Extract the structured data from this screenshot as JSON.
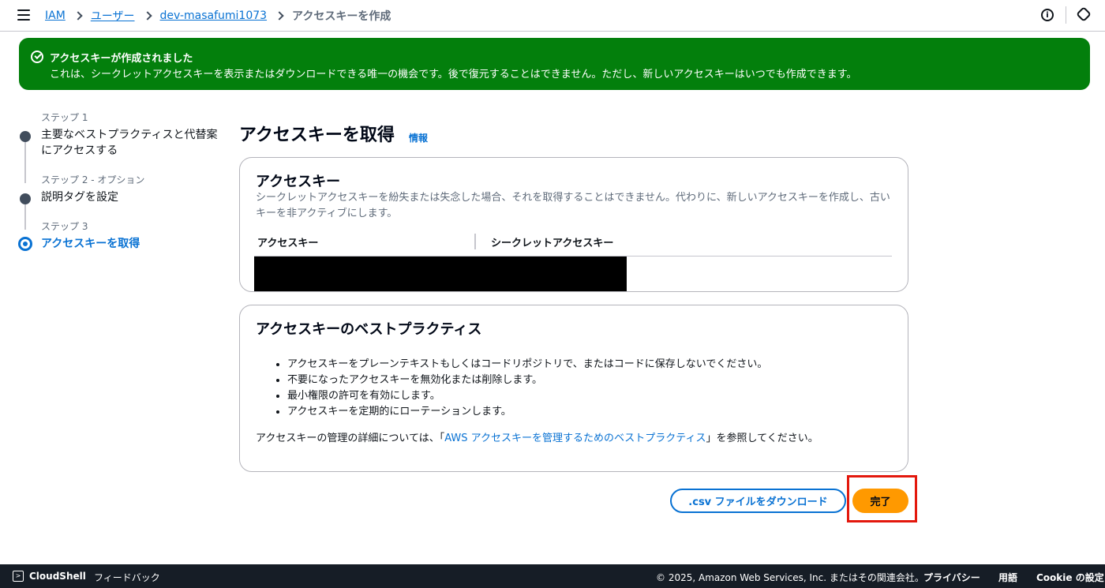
{
  "topbar": {
    "breadcrumbs": [
      "IAM",
      "ユーザー",
      "dev-masafumi1073"
    ],
    "current": "アクセスキーを作成",
    "icons": [
      "menu-icon",
      "info-icon",
      "settings-icon"
    ]
  },
  "flash": {
    "title": "アクセスキーが作成されました",
    "body": "これは、シークレットアクセスキーを表示またはダウンロードできる唯一の機会です。後で復元することはできません。ただし、新しいアクセスキーはいつでも作成できます。",
    "color": "#037f0c"
  },
  "steps": [
    {
      "label": "ステップ 1",
      "title": "主要なベストプラクティスと代替案にアクセスする"
    },
    {
      "label": "ステップ 2 - オプション",
      "title": "説明タグを設定"
    },
    {
      "label": "ステップ 3",
      "title": "アクセスキーを取得"
    }
  ],
  "main": {
    "title": "アクセスキーを取得",
    "info": "情報"
  },
  "access_key_card": {
    "title": "アクセスキー",
    "description": "シークレットアクセスキーを紛失または失念した場合、それを取得することはできません。代わりに、新しいアクセスキーを作成し、古いキーを非アクティブにします。",
    "col_access_key": "アクセスキー",
    "col_secret_key": "シークレットアクセスキー"
  },
  "best_practices_card": {
    "title": "アクセスキーのベストプラクティス",
    "items": [
      "アクセスキーをプレーンテキストもしくはコードリポジトリで、またはコードに保存しないでください。",
      "不要になったアクセスキーを無効化または削除します。",
      "最小権限の許可を有効にします。",
      "アクセスキーを定期的にローテーションします。"
    ],
    "note_prefix": "アクセスキーの管理の詳細については、「",
    "note_link": "AWS アクセスキーを管理するためのベストプラクティス",
    "note_suffix": "」を参照してください。"
  },
  "actions": {
    "download": ".csv ファイルをダウンロード",
    "done": "完了"
  },
  "footer": {
    "cloudshell": "CloudShell",
    "feedback": "フィードバック",
    "copyright": "© 2025, Amazon Web Services, Inc. またはその関連会社。",
    "privacy": "プライバシー",
    "terms": "用語",
    "cookie": "Cookie の設定"
  }
}
